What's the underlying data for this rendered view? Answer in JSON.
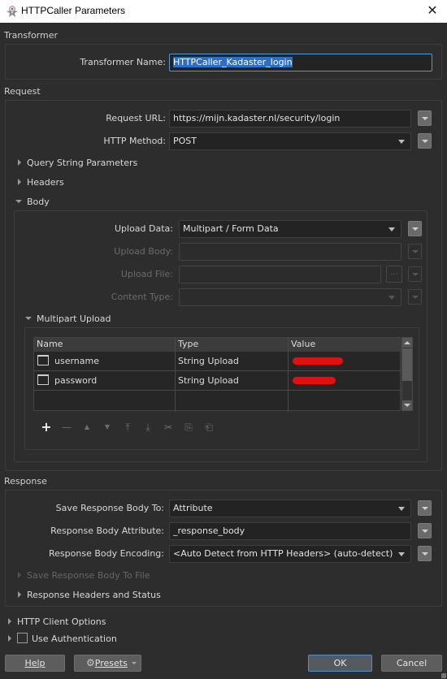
{
  "window": {
    "title": "HTTPCaller Parameters",
    "icon": "fme-transformer-icon",
    "close_icon": "close-icon"
  },
  "transformer": {
    "section_title": "Transformer",
    "name_label": "Transformer Name:",
    "name_value": "HTTPCaller_Kadaster_login"
  },
  "request": {
    "section_title": "Request",
    "url_label": "Request URL:",
    "url_value": "https://mijn.kadaster.nl/security/login",
    "method_label": "HTTP Method:",
    "method_value": "POST",
    "query_string_label": "Query String Parameters",
    "headers_label": "Headers",
    "body_label": "Body",
    "body": {
      "upload_data_label": "Upload Data:",
      "upload_data_value": "Multipart / Form Data",
      "upload_body_label": "Upload Body:",
      "upload_body_value": "",
      "upload_file_label": "Upload File:",
      "upload_file_value": "",
      "upload_file_browse": "...",
      "content_type_label": "Content Type:",
      "content_type_value": "",
      "multipart_label": "Multipart Upload",
      "multipart_table": {
        "columns": [
          "Name",
          "Type",
          "Value"
        ],
        "rows": [
          {
            "name": "username",
            "type": "String Upload",
            "value": "[redacted]"
          },
          {
            "name": "password",
            "type": "String Upload",
            "value": "[redacted]"
          },
          {
            "name": "",
            "type": "",
            "value": ""
          }
        ]
      },
      "toolbar": [
        {
          "name": "add-row",
          "glyph": "+",
          "enabled": true
        },
        {
          "name": "remove-row",
          "glyph": "—",
          "enabled": false
        },
        {
          "name": "move-up",
          "glyph": "▲",
          "enabled": false
        },
        {
          "name": "move-down",
          "glyph": "▼",
          "enabled": false
        },
        {
          "name": "move-top",
          "glyph": "⤒",
          "enabled": false
        },
        {
          "name": "move-bottom",
          "glyph": "⤓",
          "enabled": false
        },
        {
          "name": "cut",
          "glyph": "✂",
          "enabled": false
        },
        {
          "name": "copy",
          "glyph": "⎘",
          "enabled": false
        },
        {
          "name": "paste",
          "glyph": "⎗",
          "enabled": false
        }
      ]
    }
  },
  "response": {
    "section_title": "Response",
    "save_to_label": "Save Response Body To:",
    "save_to_value": "Attribute",
    "attribute_label": "Response Body Attribute:",
    "attribute_value": "_response_body",
    "encoding_label": "Response Body Encoding:",
    "encoding_value": "<Auto Detect from HTTP Headers> (auto-detect)",
    "save_to_file_label": "Save Response Body To File",
    "headers_status_label": "Response Headers and Status"
  },
  "http_client_options_label": "HTTP Client Options",
  "use_authentication": {
    "label": "Use Authentication",
    "checked": false
  },
  "footer": {
    "help_label": "Help",
    "presets_label": "Presets",
    "ok_label": "OK",
    "cancel_label": "Cancel"
  },
  "colors": {
    "background": "#2d2d2d",
    "accent": "#4a9be0",
    "selection": "#2a6fc9",
    "redaction": "#e01010"
  }
}
